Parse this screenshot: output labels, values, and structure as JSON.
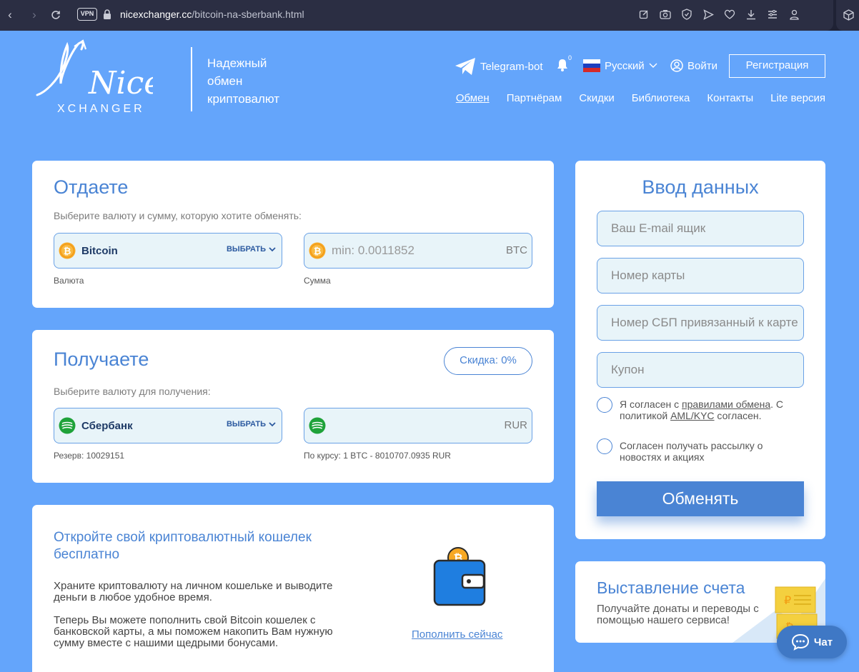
{
  "browser": {
    "vpn_label": "VPN",
    "url_host": "nicexchanger.cc",
    "url_path": "/bitcoin-na-sberbank.html"
  },
  "header": {
    "logo_text": "Nice",
    "logo_sub": "XCHANGER",
    "tagline": "Надежный обмен криптовалют",
    "telegram_label": "Telegram-bot",
    "notifications_count": "0",
    "language_label": "Русский",
    "login_label": "Войти",
    "register_label": "Регистрация"
  },
  "menu": {
    "items": [
      "Обмен",
      "Партнёрам",
      "Скидки",
      "Библиотека",
      "Контакты",
      "Lite версия"
    ]
  },
  "give": {
    "title": "Отдаете",
    "subtitle": "Выберите валюту и сумму, которую хотите обменять:",
    "currency_name": "Bitcoin",
    "choose_label": "ВЫБРАТЬ",
    "amount_placeholder": "min: 0.0011852",
    "amount_currency": "BTC",
    "currency_caption": "Валюта",
    "amount_caption": "Сумма"
  },
  "receive": {
    "title": "Получаете",
    "discount_label": "Скидка: 0%",
    "subtitle": "Выберите валюту для получения:",
    "currency_name": "Сбербанк",
    "choose_label": "ВЫБРАТЬ",
    "amount_currency": "RUR",
    "reserve_text": "Резерв: 10029151",
    "rate_text": "По курсу: 1 BTC - 8010707.0935 RUR"
  },
  "promo": {
    "title": "Откройте свой криптовалютный кошелек бесплатно",
    "text1": "Храните криптовалюту на личном кошельке и выводите деньги в любое удобное время.",
    "text2": "Теперь Вы можете пополнить свой Bitcoin кошелек с банковской карты, а мы поможем накопить Вам нужную сумму вместе с нашими щедрыми бонусами.",
    "link_label": "Пополнить сейчас"
  },
  "form": {
    "title": "Ввод данных",
    "email_placeholder": "Ваш E-mail ящик",
    "card_placeholder": "Номер карты",
    "sbp_placeholder": "Номер СБП привязанный к карте",
    "coupon_placeholder": "Купон",
    "agree_prefix": "Я согласен с ",
    "agree_rules_link": "правилами обмена",
    "agree_mid": ". С политикой ",
    "agree_aml_link": "AML/KYC",
    "agree_suffix": " согласен.",
    "newsletter_text": "Согласен получать рассылку о новостях и акциях",
    "submit_label": "Обменять"
  },
  "invoice": {
    "title": "Выставление счета",
    "text": "Получайте донаты и переводы с помощью нашего сервиса!"
  },
  "chat": {
    "label": "Чат"
  },
  "colors": {
    "page_bg": "#64a5fb",
    "accent": "#4a84d4",
    "field_bg": "#e8f4f9",
    "bitcoin": "#f7a823",
    "sber": "#1fa23a"
  }
}
